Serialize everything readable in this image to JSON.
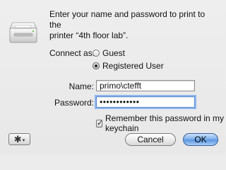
{
  "dialog": {
    "message_line1": "Enter your name and password to print to the",
    "message_line2": "printer “4th floor lab”."
  },
  "connect": {
    "label": "Connect as:",
    "options": [
      {
        "label": "Guest",
        "selected": false
      },
      {
        "label": "Registered User",
        "selected": true
      }
    ]
  },
  "form": {
    "name_label": "Name:",
    "name_value": "primo\\ctefft",
    "password_label": "Password:",
    "password_value": "••••••••••••",
    "remember_label": "Remember this password in my keychain",
    "remember_checked": true
  },
  "buttons": {
    "cancel": "Cancel",
    "ok": "OK",
    "gear_icon": "gear-icon",
    "gear_glyph": "✱",
    "caret_glyph": "▾"
  },
  "colors": {
    "default_button": "#6aa3e6",
    "focus_ring": "#8fb6ec"
  }
}
